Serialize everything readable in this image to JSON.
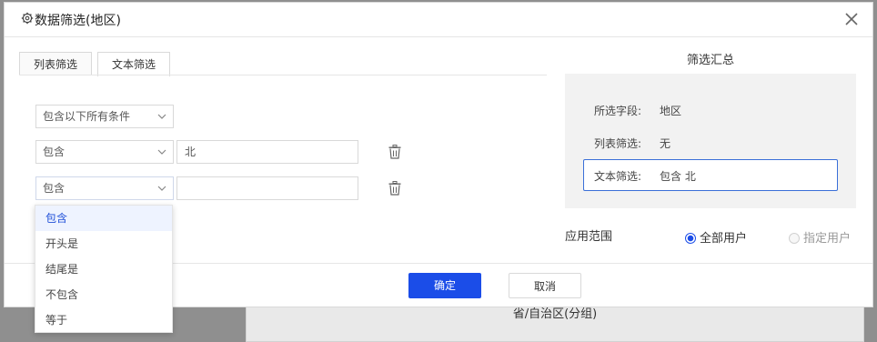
{
  "background": {
    "label": "省/自治区(分组)"
  },
  "dialog": {
    "title": "数据筛选(地区)",
    "tabs": [
      {
        "label": "列表筛选"
      },
      {
        "label": "文本筛选"
      }
    ],
    "condition_mode": "包含以下所有条件",
    "rows": [
      {
        "operator": "包含",
        "value": "北"
      },
      {
        "operator": "包含",
        "value": ""
      }
    ],
    "summary": {
      "title": "筛选汇总",
      "field_label": "所选字段:",
      "field_value": "地区",
      "list_label": "列表筛选:",
      "list_value": "无",
      "text_label": "文本筛选:",
      "text_value": "包含 北"
    },
    "scope": {
      "label": "应用范围",
      "options": [
        {
          "label": "全部用户",
          "selected": true
        },
        {
          "label": "指定用户",
          "selected": false
        }
      ]
    },
    "buttons": {
      "ok": "确定",
      "cancel": "取消"
    },
    "dropdown": {
      "options": [
        "包含",
        "开头是",
        "结尾是",
        "不包含",
        "等于"
      ],
      "active_index": 0
    }
  },
  "colors": {
    "accent": "#1b4de8",
    "highlight_border": "#3a6fd8",
    "summary_bg": "#f2f2f2"
  }
}
